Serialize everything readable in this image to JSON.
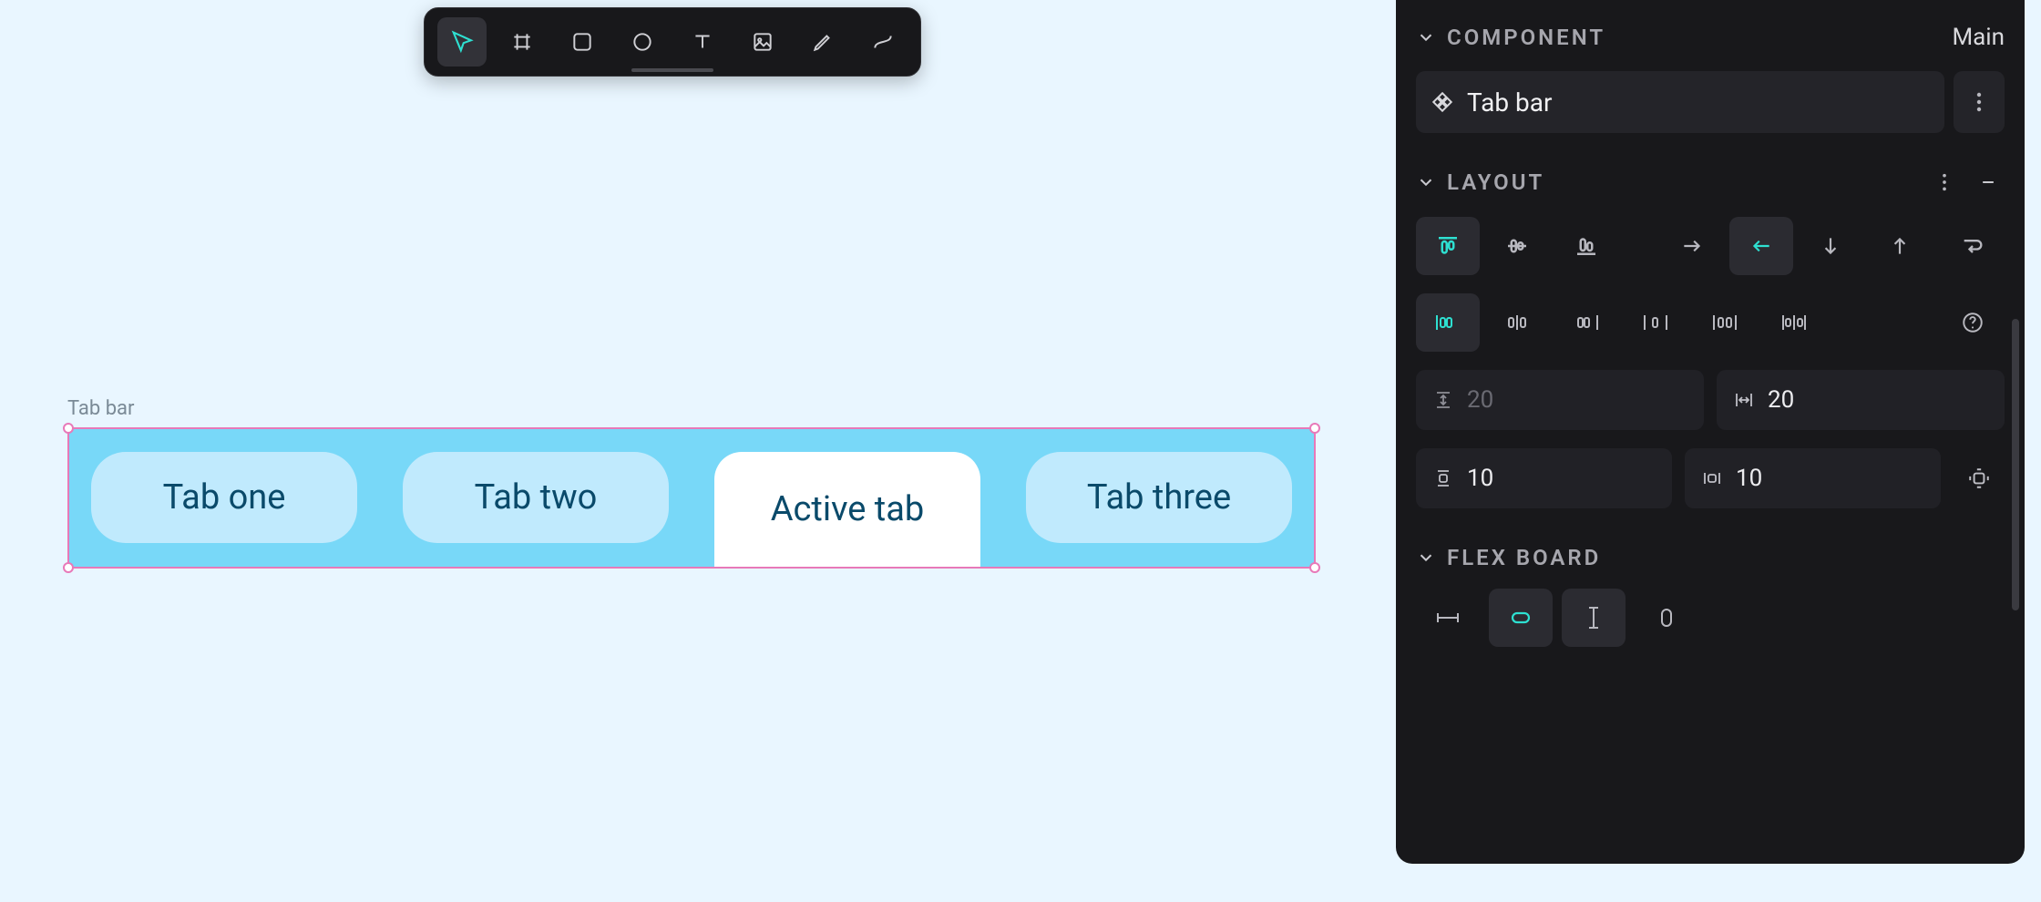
{
  "toolbar": {
    "tools": [
      "select",
      "frame",
      "rectangle",
      "ellipse",
      "text",
      "image",
      "pencil",
      "curve"
    ],
    "active": "select"
  },
  "canvas": {
    "component_label": "Tab bar",
    "tabs": [
      {
        "label": "Tab one",
        "active": false
      },
      {
        "label": "Tab two",
        "active": false
      },
      {
        "label": "Active tab",
        "active": true
      },
      {
        "label": "Tab three",
        "active": false
      }
    ]
  },
  "inspector": {
    "component_section": {
      "title": "COMPONENT",
      "variant_label": "Main"
    },
    "component_name": "Tab bar",
    "layout_section": {
      "title": "LAYOUT"
    },
    "layout": {
      "row_gap": "20",
      "column_gap": "20",
      "padding_vertical": "10",
      "padding_horizontal": "10"
    },
    "flexboard_section": {
      "title": "FLEX BOARD"
    }
  }
}
